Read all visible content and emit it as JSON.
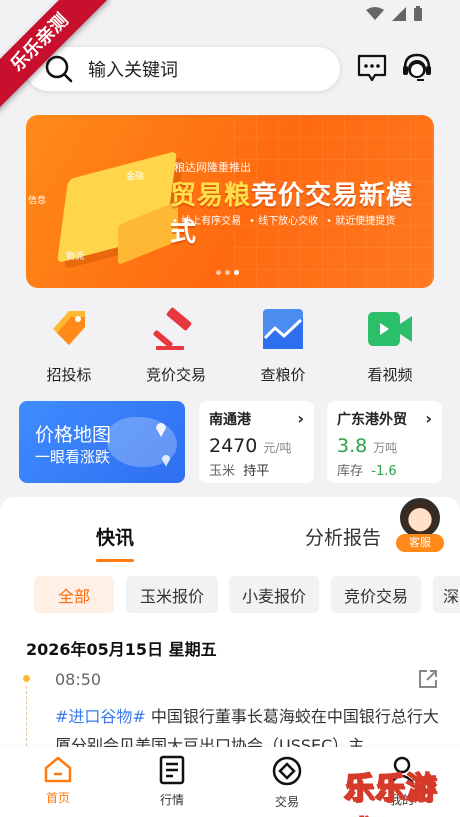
{
  "watermark_ribbon": "乐乐亲测",
  "search": {
    "placeholder": "输入关键词"
  },
  "banner": {
    "publisher": "粮达网隆重推出",
    "headline_part1": "贸易粮",
    "headline_part2": "竞价交易新模式",
    "features": [
      "线上有序交易",
      "线下放心交收",
      "就近便捷提货"
    ],
    "illustration_labels": [
      "金融",
      "信息",
      "物流"
    ],
    "dot_count": 3,
    "active_dot": 2
  },
  "quick_actions": [
    {
      "label": "招投标",
      "icon": "tag-icon"
    },
    {
      "label": "竞价交易",
      "icon": "gavel-icon"
    },
    {
      "label": "查粮价",
      "icon": "chart-icon"
    },
    {
      "label": "看视频",
      "icon": "video-icon"
    }
  ],
  "price_map": {
    "title": "价格地图",
    "subtitle": "一眼看涨跌"
  },
  "ports": [
    {
      "name": "南通港",
      "price": "2470",
      "unit": "元/吨",
      "commodity": "玉米",
      "change": "持平",
      "change_color": "#333333"
    },
    {
      "name": "广东港外贸",
      "price": "3.8",
      "unit": "万吨",
      "commodity": "库存",
      "change": "-1.6",
      "change_color": "#2aa24a",
      "price_color": "#2aa24a"
    }
  ],
  "tabs": {
    "primary": "快讯",
    "secondary": "分析报告"
  },
  "customer_service": {
    "label": "客服"
  },
  "chips": [
    "全部",
    "玉米报价",
    "小麦报价",
    "竞价交易",
    "深"
  ],
  "feed": {
    "date": "2026年05月15日 星期五",
    "time": "08:50",
    "tag": "#进口谷物#",
    "text": " 中国银行董事长葛海蛟在中国银行总行大厦分别会见美国大豆出口协会（USSEC）主"
  },
  "bottom_nav": [
    {
      "label": "首页",
      "icon": "home-icon"
    },
    {
      "label": "行情",
      "icon": "document-icon"
    },
    {
      "label": "交易",
      "icon": "target-icon"
    },
    {
      "label": "我的",
      "icon": "user-icon"
    }
  ],
  "watermark_text": "乐乐游戏",
  "colors": {
    "accent": "#ff7a10",
    "link": "#3b7bea",
    "primary_blue": "#2e6ff0"
  }
}
